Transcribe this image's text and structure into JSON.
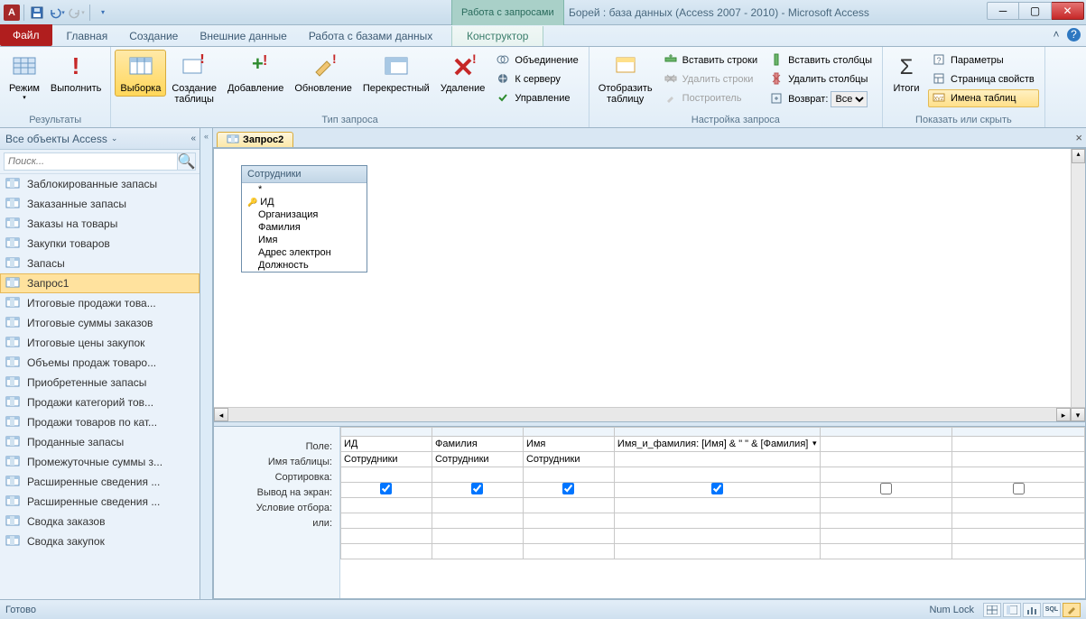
{
  "title": {
    "context_tab_title": "Работа с запросами",
    "app_title": "Борей : база данных (Access 2007 - 2010)  -  Microsoft Access"
  },
  "tabs": {
    "file": "Файл",
    "items": [
      "Главная",
      "Создание",
      "Внешние данные",
      "Работа с базами данных"
    ],
    "context": "Конструктор"
  },
  "ribbon": {
    "groups": {
      "results": {
        "label": "Результаты",
        "view": "Режим",
        "run": "Выполнить"
      },
      "querytype": {
        "label": "Тип запроса",
        "select": "Выборка",
        "maketable": "Создание\nтаблицы",
        "append": "Добавление",
        "update": "Обновление",
        "crosstab": "Перекрестный",
        "delete": "Удаление",
        "union": "Объединение",
        "passthrough": "К серверу",
        "datadef": "Управление"
      },
      "setup": {
        "label": "Настройка запроса",
        "showtable": "Отобразить\nтаблицу",
        "insrows": "Вставить строки",
        "delrows": "Удалить строки",
        "builder": "Построитель",
        "inscols": "Вставить столбцы",
        "delcols": "Удалить столбцы",
        "return_label": "Возврат:",
        "return_value": "Все"
      },
      "showhide": {
        "label": "Показать или скрыть",
        "totals": "Итоги",
        "params": "Параметры",
        "propsheet": "Страница свойств",
        "tablenames": "Имена таблиц"
      }
    }
  },
  "navpane": {
    "header": "Все объекты Access",
    "search_placeholder": "Поиск...",
    "items": [
      "Заблокированные запасы",
      "Заказанные запасы",
      "Заказы на товары",
      "Закупки товаров",
      "Запасы",
      "Запрос1",
      "Итоговые продажи това...",
      "Итоговые суммы заказов",
      "Итоговые цены закупок",
      "Объемы продаж товаро...",
      "Приобретенные запасы",
      "Продажи категорий тов...",
      "Продажи товаров по кат...",
      "Проданные запасы",
      "Промежуточные суммы з...",
      "Расширенные сведения ...",
      "Расширенные сведения ...",
      "Сводка заказов",
      "Сводка закупок"
    ],
    "selected_index": 5
  },
  "doc": {
    "tab_label": "Запрос2"
  },
  "tablecard": {
    "title": "Сотрудники",
    "fields": [
      "*",
      "ИД",
      "Организация",
      "Фамилия",
      "Имя",
      "Адрес электрон",
      "Должность"
    ],
    "key_index": 1
  },
  "grid": {
    "row_labels": [
      "Поле:",
      "Имя таблицы:",
      "Сортировка:",
      "Вывод на экран:",
      "Условие отбора:",
      "или:"
    ],
    "columns": [
      {
        "field": "ИД",
        "table": "Сотрудники",
        "show": true
      },
      {
        "field": "Фамилия",
        "table": "Сотрудники",
        "show": true
      },
      {
        "field": "Имя",
        "table": "Сотрудники",
        "show": true
      },
      {
        "field": "Имя_и_фамилия: [Имя] & \" \" & [Фамилия]",
        "table": "",
        "show": true
      },
      {
        "field": "",
        "table": "",
        "show": false
      },
      {
        "field": "",
        "table": "",
        "show": false
      }
    ]
  },
  "status": {
    "ready": "Готово",
    "numlock": "Num Lock"
  }
}
